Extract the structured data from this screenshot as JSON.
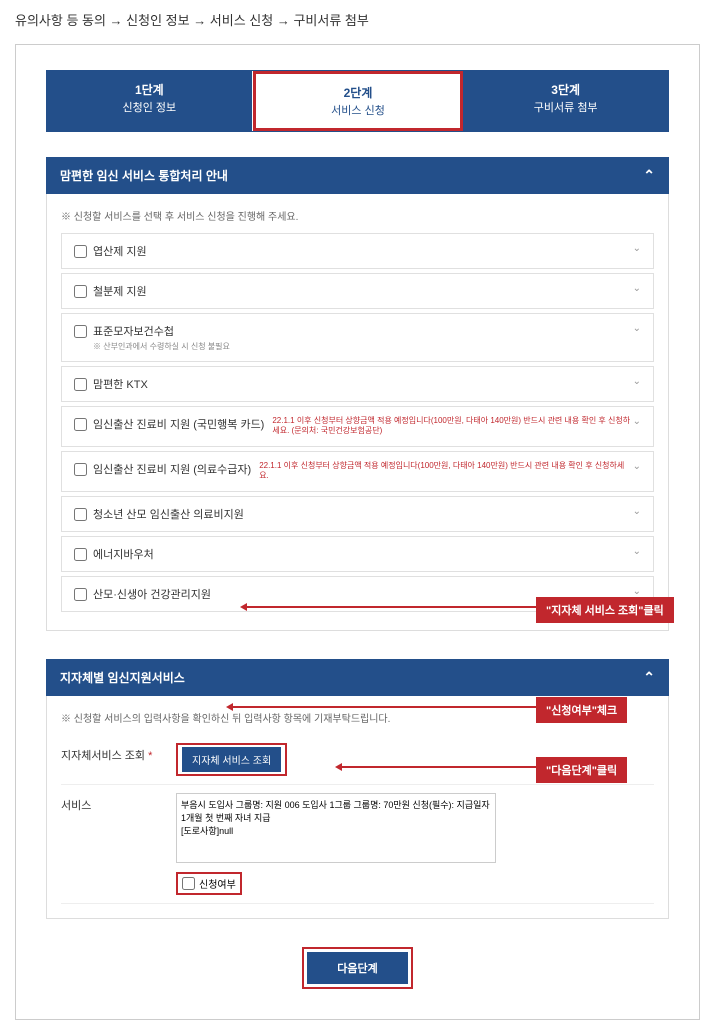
{
  "breadcrumb": "유의사항 등 동의 → 신청인 정보 → 서비스 신청 → 구비서류 첨부",
  "steps": [
    {
      "title": "1단계",
      "label": "신청인 정보"
    },
    {
      "title": "2단계",
      "label": "서비스 신청"
    },
    {
      "title": "3단계",
      "label": "구비서류 첨부"
    }
  ],
  "section1": {
    "header": "맘편한 임신 서비스 통합처리 안내",
    "notice": "※ 신청할 서비스를 선택 후 서비스 신청을 진행해 주세요.",
    "items": {
      "i0": {
        "label": "엽산제 지원"
      },
      "i1": {
        "label": "철분제 지원"
      },
      "i2": {
        "label": "표준모자보건수첩",
        "subnote": "※ 산부인과에서 수령하실 시 신청 불필요"
      },
      "i3": {
        "label": "맘편한 KTX"
      },
      "i4": {
        "label": "임신출산 진료비 지원 (국민행복 카드)",
        "warning": "22.1.1 이후 신청부터 상향금액 적용 예정입니다(100만원, 다태아 140만원) 반드시 관련 내용 확인 후 신청하세요. (문의처: 국민건강보험공단)"
      },
      "i5": {
        "label": "임신출산 진료비 지원 (의료수급자)",
        "warning": "22.1.1 이후 신청부터 상향금액 적용 예정입니다(100만원, 다태아 140만원) 반드시 관련 내용 확인 후 신청하세요."
      },
      "i6": {
        "label": "청소년 산모 임신출산 의료비지원"
      },
      "i7": {
        "label": "에너지바우처"
      },
      "i8": {
        "label": "산모·신생아 건강관리지원"
      }
    }
  },
  "section2": {
    "header": "지자체별 임신지원서비스",
    "notice": "※ 신청할 서비스의 입력사항을 확인하신 뒤 입력사항 항목에 기재부탁드립니다.",
    "lookup_label": "지자체서비스 조회",
    "lookup_button": "지자체 서비스 조회",
    "service_label": "서비스",
    "textarea_value": "부음시 도입사 그룹명: 지원 006 도입사 1그룹 그룹명: 70만원 신청(필수): 지급일자 1개월 첫 번째 자녀 지급\n[도로사항]null",
    "apply_label": "신청여부"
  },
  "next_button": "다음단계",
  "callouts": {
    "c1": "\"지자체 서비스 조회\"클릭",
    "c2": "\"신청여부\"체크",
    "c3": "\"다음단계\"클릭"
  }
}
